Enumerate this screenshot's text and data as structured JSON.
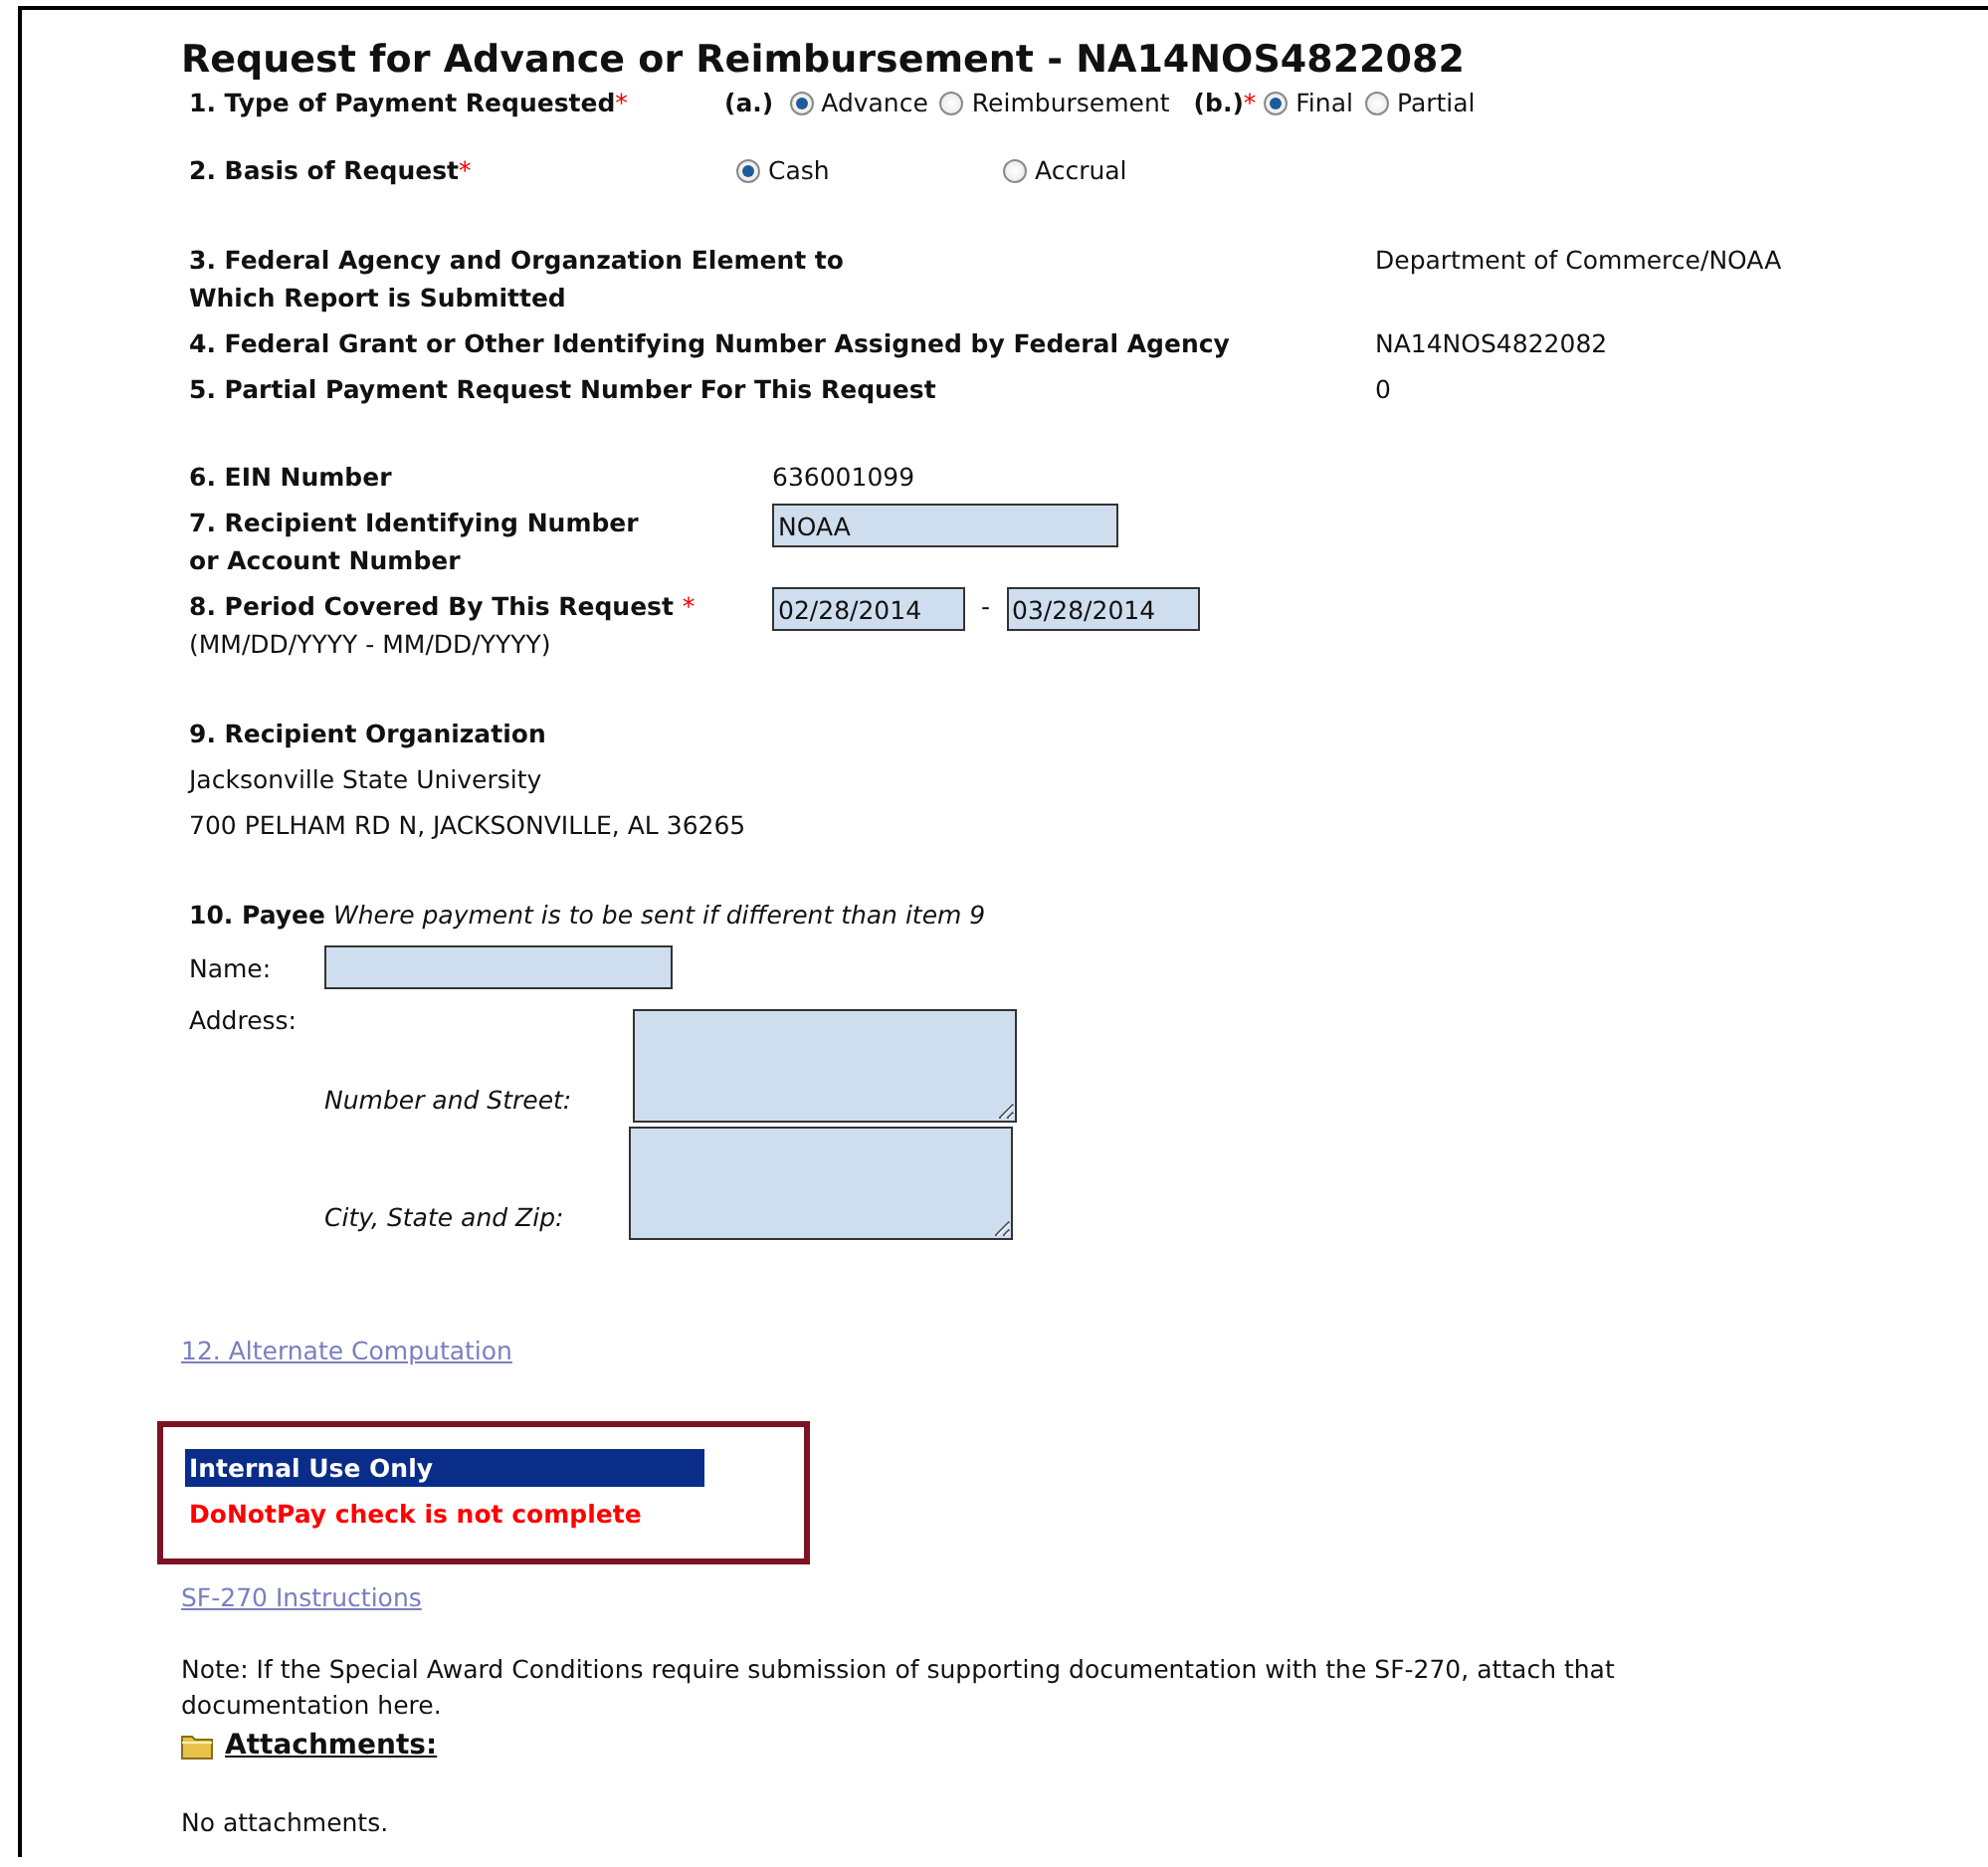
{
  "title": "Request for Advance or Reimbursement - NA14NOS4822082",
  "payment_type": {
    "label": "1. Type of Payment Requested",
    "required_mark": "*",
    "part_a": {
      "label": "(a.)",
      "options": [
        {
          "label": "Advance",
          "selected": true
        },
        {
          "label": "Reimbursement",
          "selected": false
        }
      ]
    },
    "part_b": {
      "label": "(b.)",
      "required_mark": "*",
      "options": [
        {
          "label": "Final",
          "selected": true
        },
        {
          "label": "Partial",
          "selected": false
        }
      ]
    }
  },
  "basis": {
    "label": "2. Basis of Request",
    "required_mark": "*",
    "options": [
      {
        "label": "Cash",
        "selected": true
      },
      {
        "label": "Accrual",
        "selected": false
      }
    ]
  },
  "info_rows": [
    {
      "label_lines": [
        "3. Federal Agency and Organzation Element to",
        "Which Report is Submitted"
      ],
      "value": "Department of Commerce/NOAA"
    },
    {
      "label_lines": [
        "4. Federal Grant or Other Identifying Number Assigned by Federal Agency"
      ],
      "value": "NA14NOS4822082"
    },
    {
      "label_lines": [
        "5. Partial Payment Request Number For This Request"
      ],
      "value": "0"
    }
  ],
  "ein": {
    "label": "6. EIN Number",
    "value": "636001099"
  },
  "account": {
    "label_lines": [
      "7. Recipient Identifying Number",
      "or Account Number"
    ],
    "value": "NOAA"
  },
  "period": {
    "label": "8. Period Covered By This Request",
    "required_mark": "*",
    "hint": "(MM/DD/YYYY - MM/DD/YYYY)",
    "start": "02/28/2014",
    "separator": "-",
    "end": "03/28/2014"
  },
  "organization": {
    "label": "9. Recipient Organization",
    "lines": [
      "Jacksonville State University",
      "700 PELHAM RD N, JACKSONVILLE, AL 36265"
    ]
  },
  "payee": {
    "label": "10. Payee",
    "note": "Where payment is to be sent if different than item 9",
    "name_label": "Name:",
    "address_label": "Address:",
    "street_label": "Number and Street:",
    "city_label": "City, State and Zip:"
  },
  "alternate_link": "12. Alternate Computation",
  "internal": {
    "header": "Internal Use Only",
    "message": "DoNotPay check is not complete"
  },
  "instructions_link": "SF-270 Instructions",
  "note": "Note: If the Special Award Conditions require submission of supporting documentation with the SF-270, attach that documentation here.",
  "attachments": {
    "label": "Attachments:",
    "empty_text": "No attachments."
  }
}
